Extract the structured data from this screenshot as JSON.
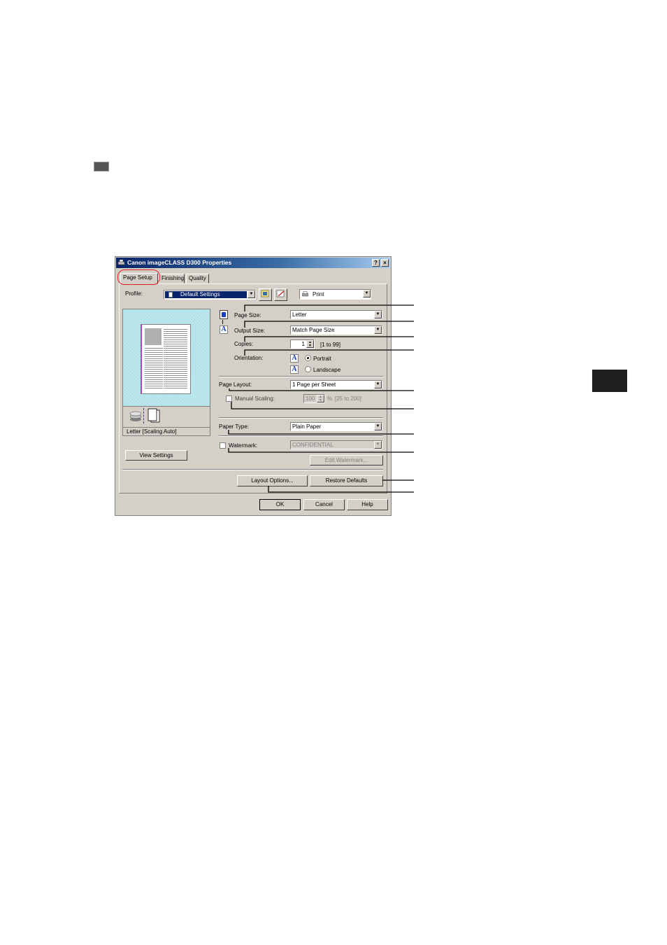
{
  "dialog": {
    "title": "Canon imageCLASS D300 Properties",
    "help_btn": "?",
    "close_btn": "×",
    "tabs": [
      "Page Setup",
      "Finishing",
      "Quality"
    ],
    "profile": {
      "label": "Profile:",
      "value": "Default Settings",
      "output_value": "Print"
    },
    "page_size": {
      "label": "Page Size:",
      "value": "Letter"
    },
    "output_size": {
      "label": "Output Size:",
      "value": "Match Page Size"
    },
    "copies": {
      "label": "Copies:",
      "value": "1",
      "range": "[1 to 99]"
    },
    "orientation": {
      "label": "Orientation:",
      "portrait": "Portrait",
      "landscape": "Landscape",
      "selected": "Portrait",
      "icon_glyph": "A"
    },
    "page_layout": {
      "label": "Page Layout:",
      "value": "1 Page per Sheet"
    },
    "manual_scaling": {
      "label": "Manual Scaling:",
      "value": "100",
      "unit": "%",
      "range": "[25 to 200]",
      "checked": false
    },
    "paper_type": {
      "label": "Paper Type:",
      "value": "Plain Paper"
    },
    "watermark": {
      "label": "Watermark:",
      "value": "CONFIDENTIAL",
      "checked": false,
      "edit_button": "Edit Watermark..."
    },
    "preview_caption": "Letter [Scaling Auto]",
    "view_settings_button": "View Settings",
    "layout_options_button": "Layout Options...",
    "restore_defaults_button": "Restore Defaults",
    "ok_button": "OK",
    "cancel_button": "Cancel",
    "help_button": "Help"
  },
  "colors": {
    "titlebar_start": "#0a246a",
    "titlebar_end": "#a6caf0",
    "profile_highlight": "#0a246a",
    "tab_circle": "#e02020",
    "side_tab": "#1e1e1e"
  },
  "icons": [
    "margin-square-icon",
    "printer-icon",
    "profile-add-icon",
    "profile-edit-icon",
    "page-size-icon",
    "output-size-icon",
    "portrait-a-icon",
    "landscape-a-icon",
    "stack-icon",
    "pages-icon"
  ]
}
